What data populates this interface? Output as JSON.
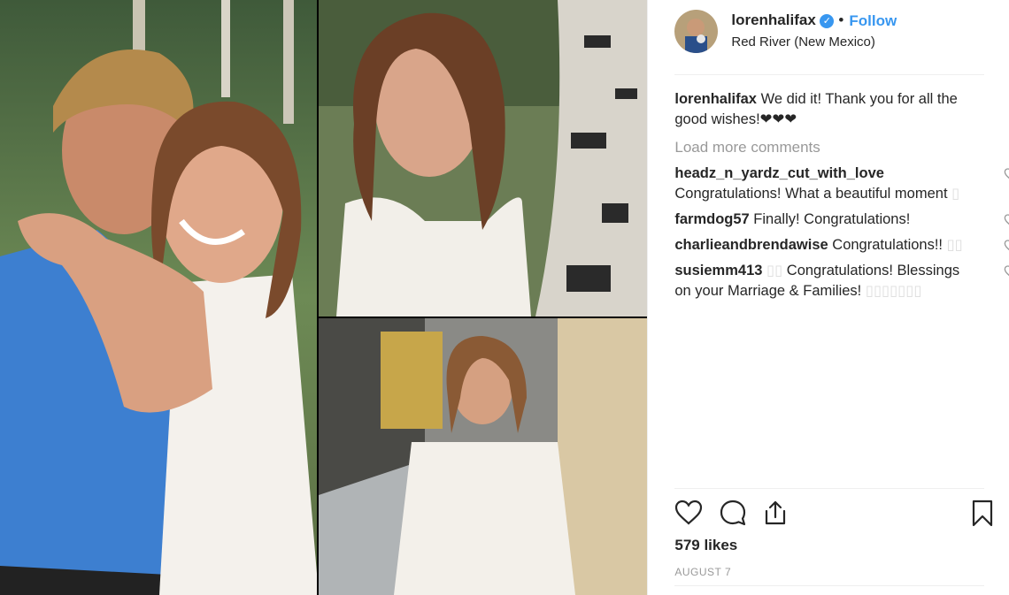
{
  "header": {
    "username": "lorenhalifax",
    "verified_mark": "✓",
    "separator": "•",
    "follow_label": "Follow",
    "location": "Red River (New Mexico)"
  },
  "caption": {
    "username": "lorenhalifax",
    "text": " We did it! Thank you for all the good wishes!❤❤❤"
  },
  "load_more_label": "Load more comments",
  "comments": [
    {
      "username": "headz_n_yardz_cut_with_love",
      "text": " Congratulations! What a beautiful moment",
      "trail": " ▯"
    },
    {
      "username": "farmdog57",
      "text": " Finally! Congratulations!",
      "trail": ""
    },
    {
      "username": "charlieandbrendawise",
      "text": " Congratulations!!",
      "trail": " ▯▯"
    },
    {
      "username": "susiemm413",
      "text": " Congratulations! Blessings on your Marriage & Families!",
      "lead": " ▯▯",
      "trail": " ▯▯▯▯▯▯▯"
    }
  ],
  "actions": {
    "like_icon": "heart-outline-icon",
    "comment_icon": "speech-bubble-icon",
    "share_icon": "share-icon",
    "save_icon": "bookmark-icon"
  },
  "likes_text": "579 likes",
  "date_text": "AUGUST 7",
  "colors": {
    "link_blue": "#3897f0",
    "text": "#262626",
    "muted": "#999999",
    "divider": "#efefef"
  }
}
